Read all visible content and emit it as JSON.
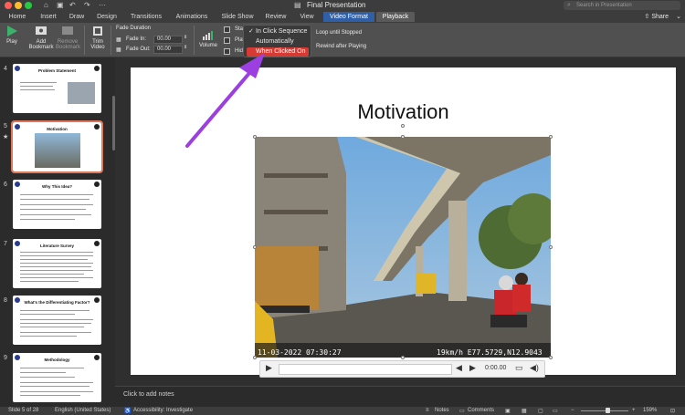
{
  "window": {
    "title": "Final Presentation",
    "search_placeholder": "Search in Presentation",
    "traffic_colors": [
      "#ff5f57",
      "#febc2e",
      "#28c840"
    ]
  },
  "tabs": [
    "Home",
    "Insert",
    "Draw",
    "Design",
    "Transitions",
    "Animations",
    "Slide Show",
    "Review",
    "View",
    "Video Format",
    "Playback"
  ],
  "share_label": "Share",
  "ribbon": {
    "play": "Play",
    "add_bookmark": "Add Bookmark",
    "remove_bookmark": "Remove Bookmark",
    "trim_video": "Trim Video",
    "fade_duration": "Fade Duration",
    "fade_in_label": "Fade In:",
    "fade_in_value": "00.00",
    "fade_out_label": "Fade Out:",
    "fade_out_value": "00.00",
    "volume": "Volume",
    "start_partial": "Sta",
    "play_full_partial": "Play",
    "hide_partial": "Hid",
    "loop_label": "Loop until Stopped",
    "rewind_label": "Rewind after Playing"
  },
  "start_menu": {
    "items": [
      "In Click Sequence",
      "Automatically",
      "When Clicked On"
    ],
    "checked_index": 0,
    "highlighted_index": 2,
    "highlight_color": "#d63a33"
  },
  "slides": [
    {
      "num": "4",
      "title": "Problem Statement"
    },
    {
      "num": "5",
      "title": "Motivation"
    },
    {
      "num": "6",
      "title": "Why This Idea?"
    },
    {
      "num": "7",
      "title": "Literature Survey"
    },
    {
      "num": "8",
      "title": "What's the Differentiating Factor?"
    },
    {
      "num": "9",
      "title": "Methodology"
    }
  ],
  "thumb_logo_text": "PES",
  "selected_slide_mark": "★",
  "main_slide": {
    "title": "Motivation",
    "video_timestamp": "11-03-2022 07:30:27",
    "video_gps": "19km/h E77.5729,N12.9043"
  },
  "player": {
    "time": "0:00.00"
  },
  "notes_placeholder": "Click to add notes",
  "status": {
    "slide_count": "Slide 5 of 28",
    "language": "English (United States)",
    "accessibility": "Accessibility: Investigate",
    "notes": "Notes",
    "comments": "Comments",
    "zoom": "159%"
  },
  "accent_colors": {
    "video_format_tab": "#2f5fa7",
    "arrow": "#9b3fe0",
    "selected_thumb_border": "#e0785c"
  }
}
